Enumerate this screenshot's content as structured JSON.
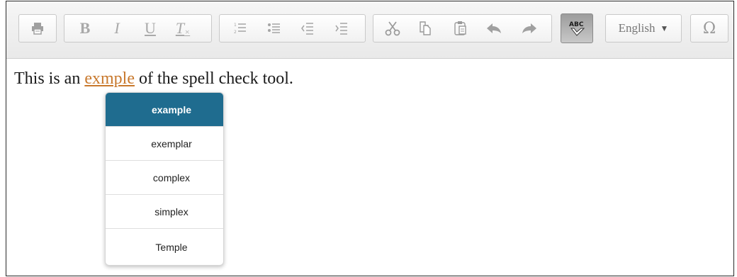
{
  "toolbar": {
    "format_buttons": {
      "bold": "B",
      "italic": "I",
      "underline": "U",
      "remove_format": "T"
    },
    "spellcheck_label": "ABC",
    "language": "English",
    "special_char": "Ω"
  },
  "editor": {
    "text_before": "This is an ",
    "misspelled_word": "exmple",
    "text_after": " of the spell check tool."
  },
  "suggestions": [
    "example",
    "exemplar",
    "complex",
    "simplex",
    "Temple"
  ],
  "colors": {
    "misspelled": "#c8782c",
    "menu_selected": "#1f6c8f"
  }
}
